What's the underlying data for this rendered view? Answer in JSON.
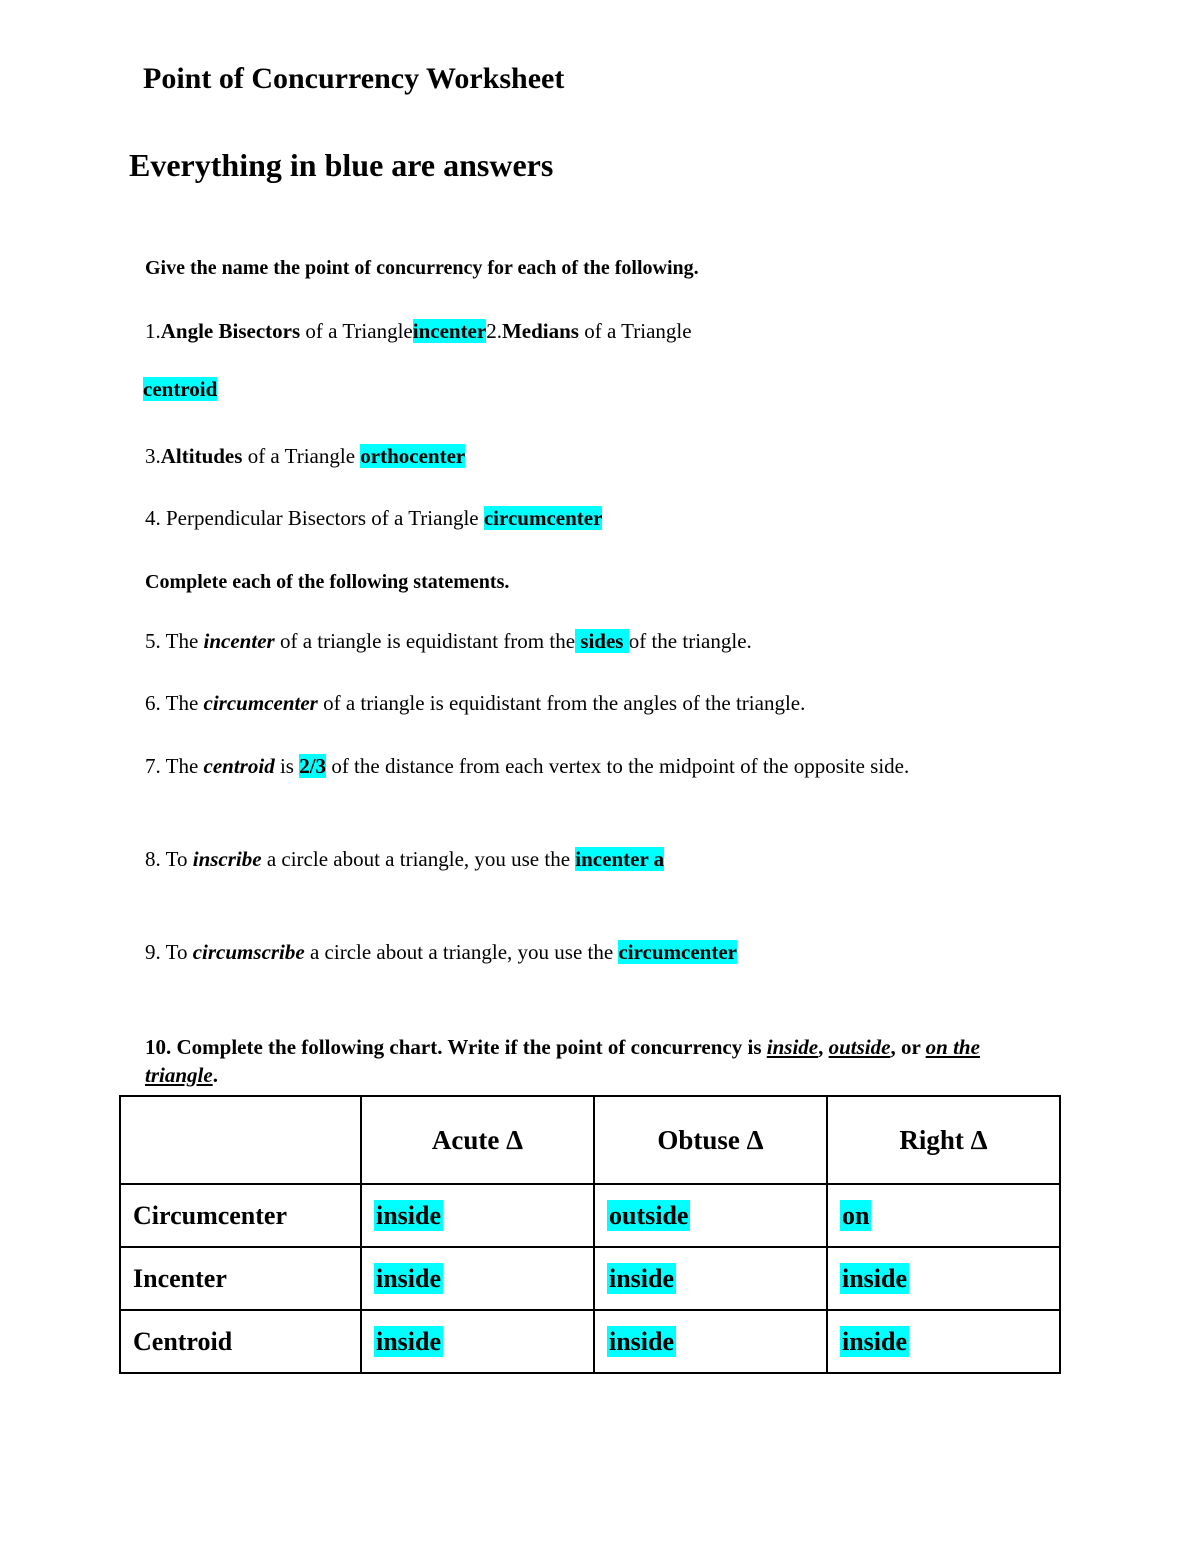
{
  "document": {
    "title": "Point of Concurrency Worksheet",
    "subtitle": "Everything in blue  are answers"
  },
  "sections": {
    "naming_heading": "Give the name the point of concurrency for each of the following.",
    "statements_heading": "Complete each of the following statements."
  },
  "questions": {
    "q1": {
      "number": "1.",
      "bold_term": "Angle Bisectors",
      "text_mid": " of a Triangle",
      "answer": "incenter",
      "tail_number": "2.",
      "tail_bold_term": "Medians",
      "tail_text": " of a Triangle"
    },
    "q2_answer": "centroid ",
    "q3": {
      "number": "3.",
      "bold_term": "Altitudes",
      "text_mid": " of a Triangle ",
      "answer": "orthocenter"
    },
    "q4": {
      "number": "4.",
      "text_start": " Perpendicular Bisectors of a Triangle ",
      "answer": "circumcenter"
    },
    "q5": {
      "number": "5.",
      "text_start": " The ",
      "italic_term": "incenter",
      "text_mid": " of a triangle is equidistant from the",
      "answer": " sides ",
      "text_end": "of the   triangle."
    },
    "q6": {
      "number": "6.",
      "text_start": " The ",
      "italic_term": "circumcenter",
      "text_end": " of a triangle is equidistant from the  angles of   the triangle."
    },
    "q7": {
      "number": "7.",
      "text_start": " The ",
      "italic_term": "centroid",
      "text_mid": " is ",
      "answer": "2/3",
      "text_end": " of the distance from each vertex to the midpoint   of the opposite side."
    },
    "q8": {
      "number": "8.",
      "text_start": " To ",
      "italic_term": "inscribe",
      "text_mid": " a circle about a triangle, you use the ",
      "answer": "incenter a"
    },
    "q9": {
      "number": "9.",
      "text_start": " To ",
      "italic_term": "circumscribe",
      "text_mid": " a circle about a triangle, you use the ",
      "answer": "circumcenter",
      "answer_red": " "
    },
    "q10": {
      "number": "10.",
      "text_start": " Complete the following chart. Write if the point of concurrency is ",
      "term_inside": "inside",
      "text_comma": ", ",
      "term_outside": "outside",
      "text_or": ", or ",
      "term_on": "on the triangle",
      "text_end": "."
    }
  },
  "chart_data": {
    "type": "table",
    "columns": [
      "",
      "Acute Δ",
      "Obtuse Δ",
      "Right Δ"
    ],
    "rows": [
      {
        "label": "Circumcenter",
        "values": [
          "inside",
          "outside",
          "on"
        ]
      },
      {
        "label": "Incenter",
        "values": [
          "inside",
          "inside",
          "inside"
        ]
      },
      {
        "label": "Centroid",
        "values": [
          "inside",
          "inside",
          "inside"
        ]
      }
    ]
  },
  "colors": {
    "highlight": "#00ffff",
    "highlight_alt": "#ff0000",
    "text": "#000000",
    "background": "#ffffff"
  }
}
